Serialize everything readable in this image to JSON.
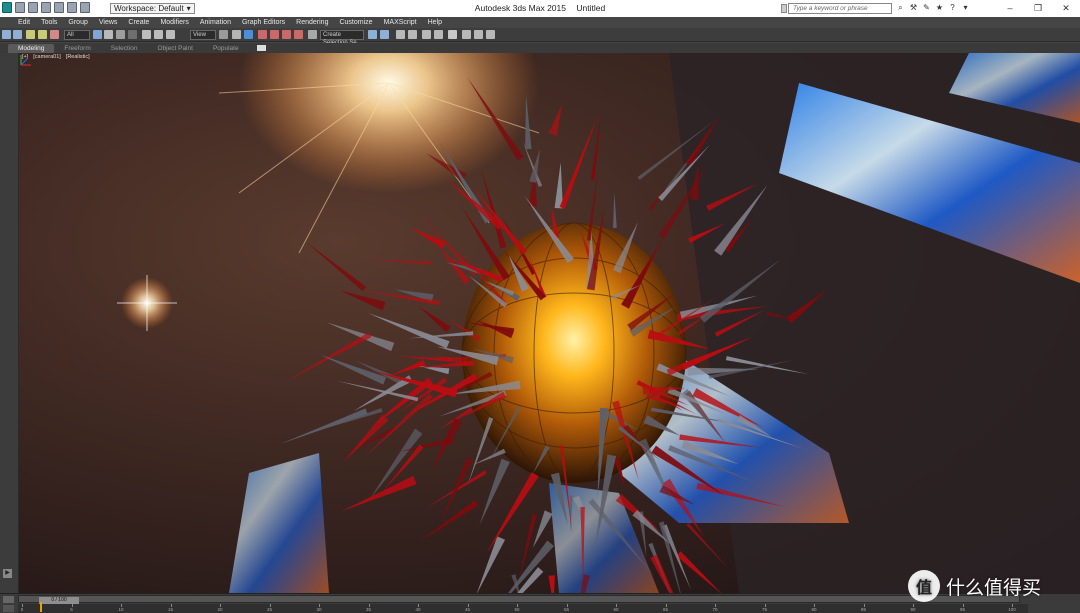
{
  "titlebar": {
    "workspace_label": "Workspace: Default",
    "app_name": "Autodesk 3ds Max  2015",
    "doc_name": "Untitled",
    "search_placeholder": "Type a keyword or phrase",
    "window_controls": [
      "–",
      "❐",
      "✕"
    ]
  },
  "menu": [
    "Edit",
    "Tools",
    "Group",
    "Views",
    "Create",
    "Modifiers",
    "Animation",
    "Graph Editors",
    "Rendering",
    "Customize",
    "MAXScript",
    "Help"
  ],
  "toolbar": {
    "selection_filter": "All",
    "ref_coord": "View",
    "named_selection": "Create Selection Se"
  },
  "ribbon_tabs": [
    "Modeling",
    "Freeform",
    "Selection",
    "Object Paint",
    "Populate"
  ],
  "ribbon_active": "Modeling",
  "viewport": {
    "labels": [
      "[+]",
      "[camera01]",
      "[Realistic]"
    ]
  },
  "timeline": {
    "frame_display": "0 / 100",
    "ticks": [
      "0",
      "5",
      "10",
      "15",
      "20",
      "25",
      "30",
      "35",
      "40",
      "45",
      "50",
      "55",
      "60",
      "65",
      "70",
      "75",
      "80",
      "85",
      "90",
      "95",
      "100"
    ]
  },
  "watermark": {
    "logo_glyph": "值",
    "text": "什么值得买"
  }
}
